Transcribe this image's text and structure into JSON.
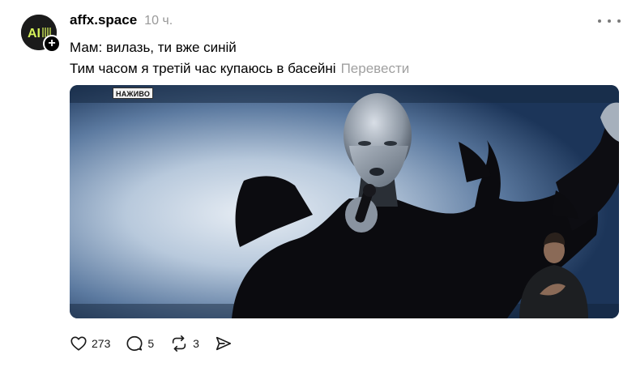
{
  "post": {
    "avatar_text": "AI",
    "username": "affx.space",
    "timestamp": "10 ч.",
    "lines": [
      "Мам: вилазь, ти вже синій",
      "Тим часом я третій час купаюсь в басейні"
    ],
    "translate_label": "Перевести"
  },
  "media": {
    "live_badge": "НАЖИВО"
  },
  "actions": {
    "likes": "273",
    "replies": "5",
    "reposts": "3"
  },
  "icons": {
    "more": "more-horizontal-icon",
    "like": "heart-icon",
    "reply": "comment-icon",
    "repost": "repost-icon",
    "share": "send-icon"
  },
  "colors": {
    "muted": "#999999",
    "translate": "#a0a0a0",
    "icon": "#1a1a1a"
  }
}
